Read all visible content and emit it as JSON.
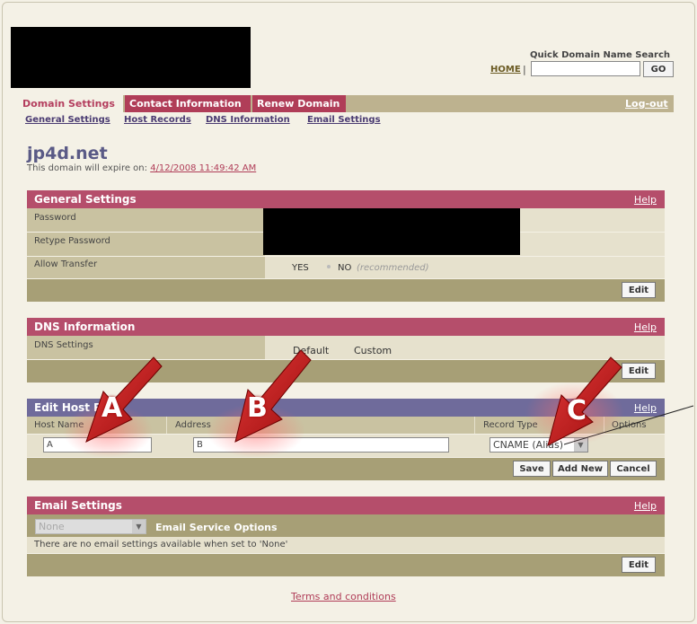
{
  "header": {
    "quick_search_label": "Quick Domain Name Search",
    "home_link": "HOME",
    "separator": "|",
    "search_value": "",
    "go_button": "GO"
  },
  "nav": {
    "tabs": [
      {
        "label": "Domain Settings",
        "active": true
      },
      {
        "label": "Contact Information",
        "active": false
      },
      {
        "label": "Renew Domain",
        "active": false
      }
    ],
    "logout": "Log-out",
    "subnav": [
      "General Settings",
      "Host Records",
      "DNS Information",
      "Email Settings"
    ]
  },
  "domain": {
    "name": "jp4d.net",
    "expire_prefix": "This domain will expire on:",
    "expire_date": "4/12/2008 11:49:42 AM"
  },
  "general_settings": {
    "title": "General Settings",
    "help": "Help",
    "password_label": "Password",
    "retype_label": "Retype Password",
    "transfer_label": "Allow Transfer",
    "transfer_yes": "YES",
    "transfer_no": "NO",
    "transfer_recommended": "(recommended)",
    "edit": "Edit"
  },
  "dns_info": {
    "title": "DNS Information",
    "help": "Help",
    "settings_label": "DNS Settings",
    "option_default": "Default",
    "option_custom": "Custom",
    "edit": "Edit"
  },
  "edit_host": {
    "title": "Edit Host R",
    "help": "Help",
    "col_host": "Host Name",
    "col_address": "Address",
    "col_record": "Record Type",
    "col_options": "Options",
    "host_value": "A",
    "address_value": "B",
    "record_value": "CNAME (Alias)",
    "save": "Save",
    "add_new": "Add New",
    "cancel": "Cancel"
  },
  "email_settings": {
    "title": "Email Settings",
    "help": "Help",
    "select_value": "None",
    "service_label": "Email Service Options",
    "message": "There are no email settings available when set to 'None'",
    "edit": "Edit"
  },
  "callouts": {
    "a": "A",
    "b": "B",
    "c": "C"
  },
  "footer": {
    "terms": "Terms and conditions"
  },
  "colors": {
    "accent_red": "#b03d58",
    "tan_bar": "#a79f76",
    "panel_row": "#c9c2a1",
    "background": "#f4f1e6"
  }
}
